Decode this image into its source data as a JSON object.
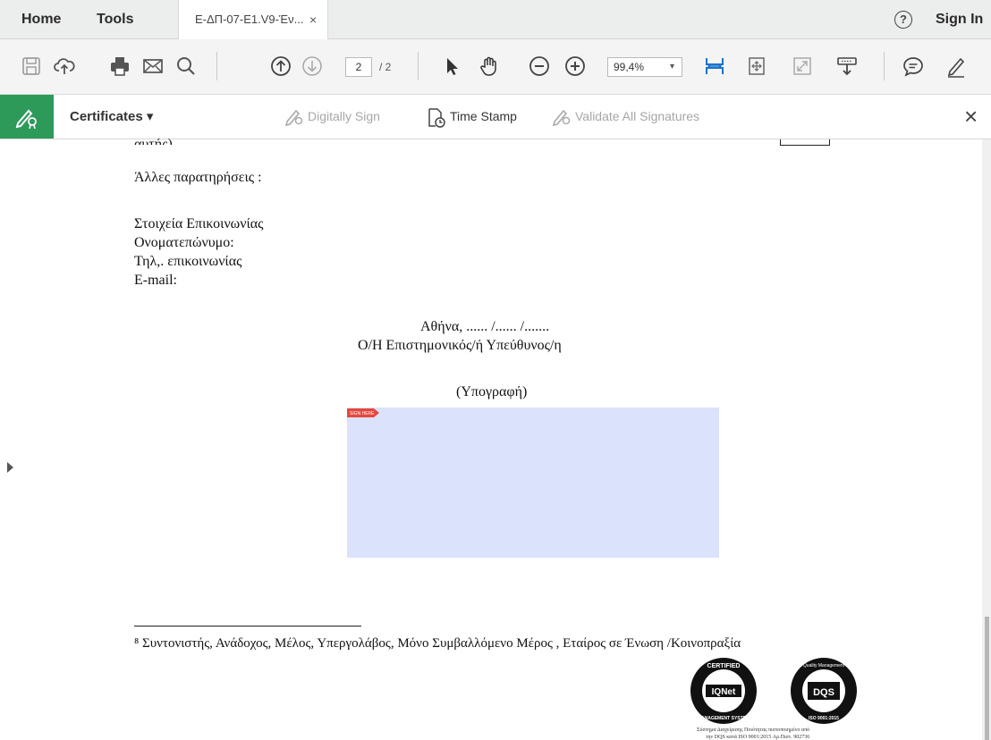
{
  "tabbar": {
    "home": "Home",
    "tools": "Tools",
    "doc_tab_title": "Ε-ΔΠ-07-Ε1.V9-Έν...",
    "doc_tab_close": "×",
    "help": "?",
    "sign_in": "Sign In"
  },
  "toolbar": {
    "page_current": "2",
    "page_total": "/ 2",
    "zoom": "99,4%",
    "zoom_caret": "▾"
  },
  "certificates_bar": {
    "menu_label": "Certificates ▾",
    "digitally_sign": "Digitally Sign",
    "time_stamp": "Time Stamp",
    "validate_all": "Validate All Signatures",
    "close": "×"
  },
  "document": {
    "cut_line": "αυτής)",
    "other_remarks": "Άλλες παρατηρήσεις :",
    "contact_heading": "Στοιχεία Επικοινωνίας",
    "full_name": "Ονοματεπώνυμο:",
    "phone": "Τηλ,. επικοινωνίας",
    "email": "E-mail:",
    "date_line": "Αθήνα, ...... /...... /.......",
    "responsible": "Ο/Η Επιστημονικός/ή Υπεύθυνος/η",
    "signature_label": "(Υπογραφή)",
    "sign_here_flag": "SIGN HERE",
    "footnote": "⁸ Συντονιστής, Ανάδοχος, Μέλος, Υπεργολάβος, Μόνο Συμβαλλόμενο Μέρος , Εταίρος σε Ένωση /Κοινοπραξία",
    "logo_caption_1": "Σύστημα Διαχείρισης Ποιότητας πιστοποιημένο από",
    "logo_caption_2": "την DQS κατά ISO 9001:2015 Αρ.Πιστ. 902736",
    "logo_iqnet_top": "CERTIFIED",
    "logo_iqnet_mid": "IQNet",
    "logo_iqnet_bottom": "MANAGEMENT SYSTEM",
    "logo_dqs_top": "Quality Management",
    "logo_dqs_mid": "DQS",
    "logo_dqs_bottom": "ISO 9001:2015"
  },
  "colors": {
    "cert_green": "#2d9a5a",
    "zoom_icon_blue": "#1a73c9",
    "signature_field": "#dbe2fc",
    "sign_flag": "#e8473c"
  }
}
